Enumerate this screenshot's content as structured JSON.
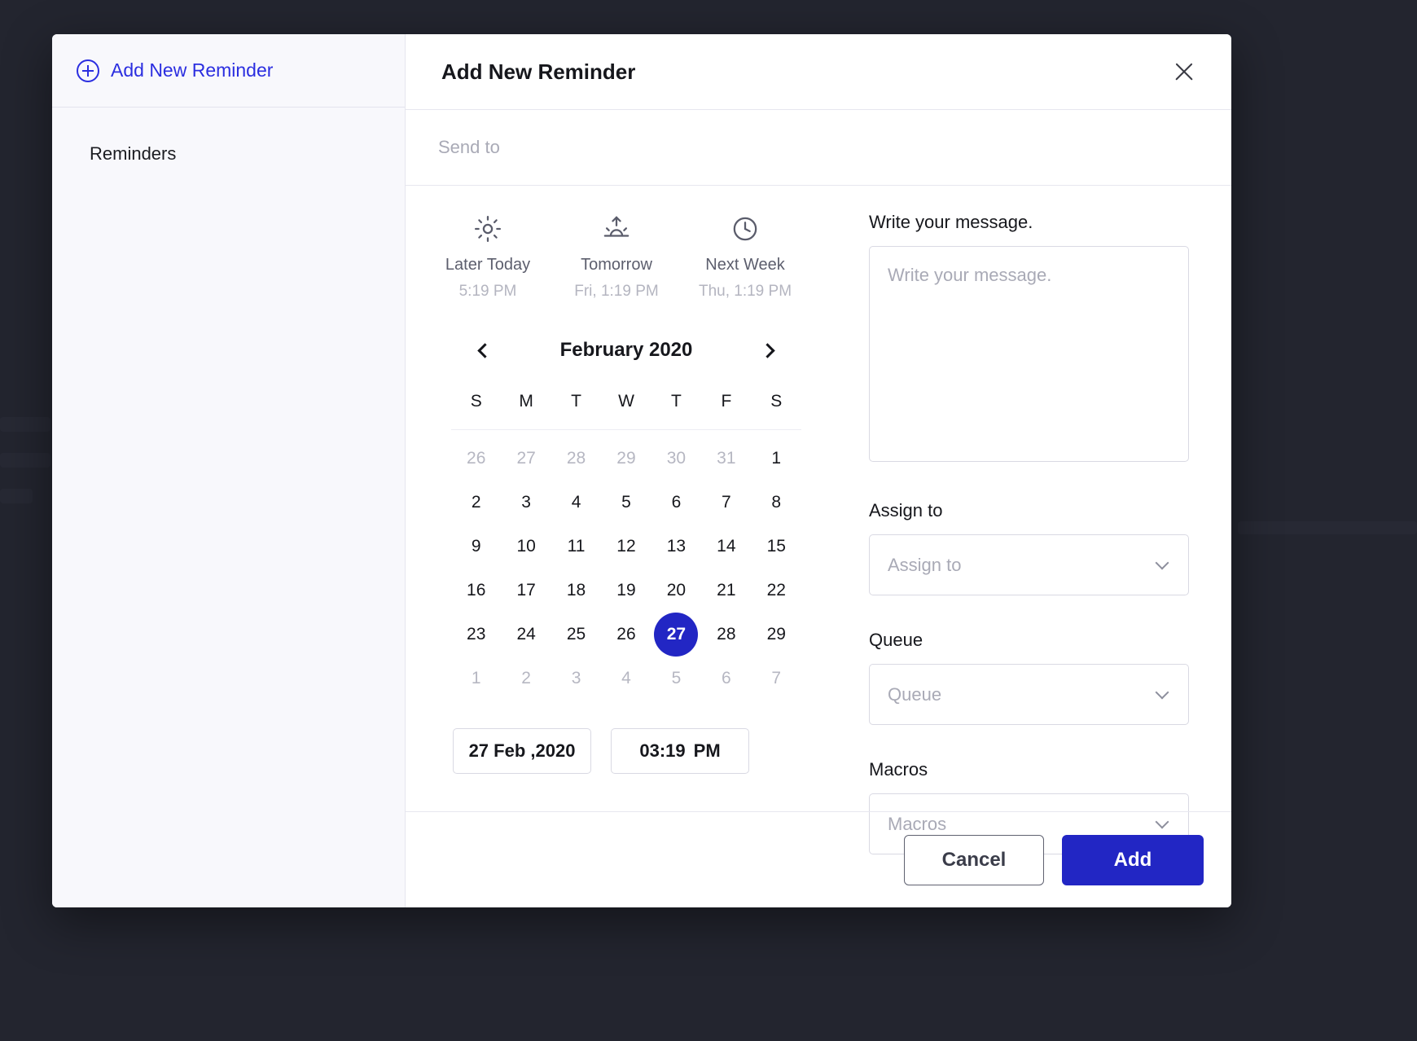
{
  "sidebar": {
    "add_new_reminder_label": "Add New Reminder",
    "section_title": "Reminders"
  },
  "header": {
    "title": "Add New Reminder",
    "close_icon": "close-icon"
  },
  "send_to": {
    "value": "",
    "placeholder": "Send to"
  },
  "quick_picks": [
    {
      "icon": "sun-icon",
      "label": "Later Today",
      "sub": "5:19 PM"
    },
    {
      "icon": "sunrise-icon",
      "label": "Tomorrow",
      "sub": "Fri, 1:19 PM"
    },
    {
      "icon": "clock-icon",
      "label": "Next Week",
      "sub": "Thu, 1:19 PM"
    }
  ],
  "calendar": {
    "month_label": "February 2020",
    "prev_icon": "chevron-left-icon",
    "next_icon": "chevron-right-icon",
    "weekday_headers": [
      "S",
      "M",
      "T",
      "W",
      "T",
      "F",
      "S"
    ],
    "selected_day": 27,
    "weeks": [
      [
        {
          "n": "26",
          "muted": true
        },
        {
          "n": "27",
          "muted": true
        },
        {
          "n": "28",
          "muted": true
        },
        {
          "n": "29",
          "muted": true
        },
        {
          "n": "30",
          "muted": true
        },
        {
          "n": "31",
          "muted": true
        },
        {
          "n": "1",
          "muted": false
        }
      ],
      [
        {
          "n": "2",
          "muted": false
        },
        {
          "n": "3",
          "muted": false
        },
        {
          "n": "4",
          "muted": false
        },
        {
          "n": "5",
          "muted": false
        },
        {
          "n": "6",
          "muted": false
        },
        {
          "n": "7",
          "muted": false
        },
        {
          "n": "8",
          "muted": false
        }
      ],
      [
        {
          "n": "9",
          "muted": false
        },
        {
          "n": "10",
          "muted": false
        },
        {
          "n": "11",
          "muted": false
        },
        {
          "n": "12",
          "muted": false
        },
        {
          "n": "13",
          "muted": false
        },
        {
          "n": "14",
          "muted": false
        },
        {
          "n": "15",
          "muted": false
        }
      ],
      [
        {
          "n": "16",
          "muted": false
        },
        {
          "n": "17",
          "muted": false
        },
        {
          "n": "18",
          "muted": false
        },
        {
          "n": "19",
          "muted": false
        },
        {
          "n": "20",
          "muted": false
        },
        {
          "n": "21",
          "muted": false
        },
        {
          "n": "22",
          "muted": false
        }
      ],
      [
        {
          "n": "23",
          "muted": false
        },
        {
          "n": "24",
          "muted": false
        },
        {
          "n": "25",
          "muted": false
        },
        {
          "n": "26",
          "muted": false
        },
        {
          "n": "27",
          "muted": false,
          "selected": true
        },
        {
          "n": "28",
          "muted": false
        },
        {
          "n": "29",
          "muted": false
        }
      ],
      [
        {
          "n": "1",
          "muted": true
        },
        {
          "n": "2",
          "muted": true
        },
        {
          "n": "3",
          "muted": true
        },
        {
          "n": "4",
          "muted": true
        },
        {
          "n": "5",
          "muted": true
        },
        {
          "n": "6",
          "muted": true
        },
        {
          "n": "7",
          "muted": true
        }
      ]
    ]
  },
  "date_value": "27 Feb ,2020",
  "time_value": "03:19",
  "time_meridiem": "PM",
  "message": {
    "label": "Write your message.",
    "value": "",
    "placeholder": "Write your message."
  },
  "assign_to": {
    "label": "Assign to",
    "value": "Assign to",
    "caret_icon": "chevron-down-icon"
  },
  "queue": {
    "label": "Queue",
    "value": "Queue",
    "caret_icon": "chevron-down-icon"
  },
  "macros": {
    "label": "Macros",
    "value": "Macros",
    "caret_icon": "chevron-down-icon"
  },
  "footer": {
    "cancel_label": "Cancel",
    "add_label": "Add"
  },
  "colors": {
    "accent": "#2226c4",
    "link": "#2b2ee0",
    "sidebar_bg": "#f8f8fc",
    "backdrop": "#23252f",
    "muted_text": "#b6b7c2",
    "placeholder": "#a9aab6"
  }
}
